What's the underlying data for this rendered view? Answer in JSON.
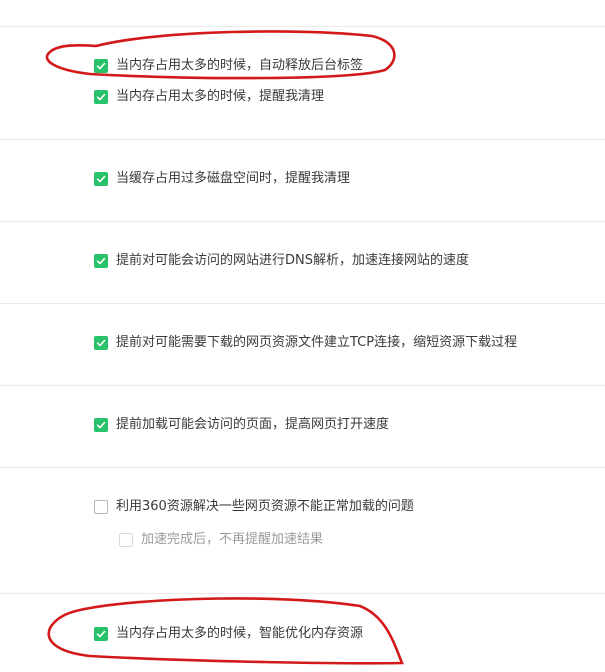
{
  "settings": {
    "options": [
      {
        "label": "当内存占用太多的时候，自动释放后台标签",
        "checked": true
      },
      {
        "label": "当内存占用太多的时候，提醒我清理",
        "checked": true
      },
      {
        "label": "当缓存占用过多磁盘空间时，提醒我清理",
        "checked": true
      },
      {
        "label": "提前对可能会访问的网站进行DNS解析，加速连接网站的速度",
        "checked": true
      },
      {
        "label": "提前对可能需要下载的网页资源文件建立TCP连接，缩短资源下载过程",
        "checked": true
      },
      {
        "label": "提前加载可能会访问的页面，提高网页打开速度",
        "checked": true
      },
      {
        "label": "利用360资源解决一些网页资源不能正常加载的问题",
        "checked": false
      },
      {
        "label": "加速完成后，不再提醒加速结果",
        "checked": false,
        "disabled": true
      },
      {
        "label": "当内存占用太多的时候，智能优化内存资源",
        "checked": true
      }
    ]
  },
  "colors": {
    "checkbox_checked": "#27c26a",
    "annotation_red": "#d21a1a"
  },
  "icons": {
    "check": "checkmark-icon"
  }
}
